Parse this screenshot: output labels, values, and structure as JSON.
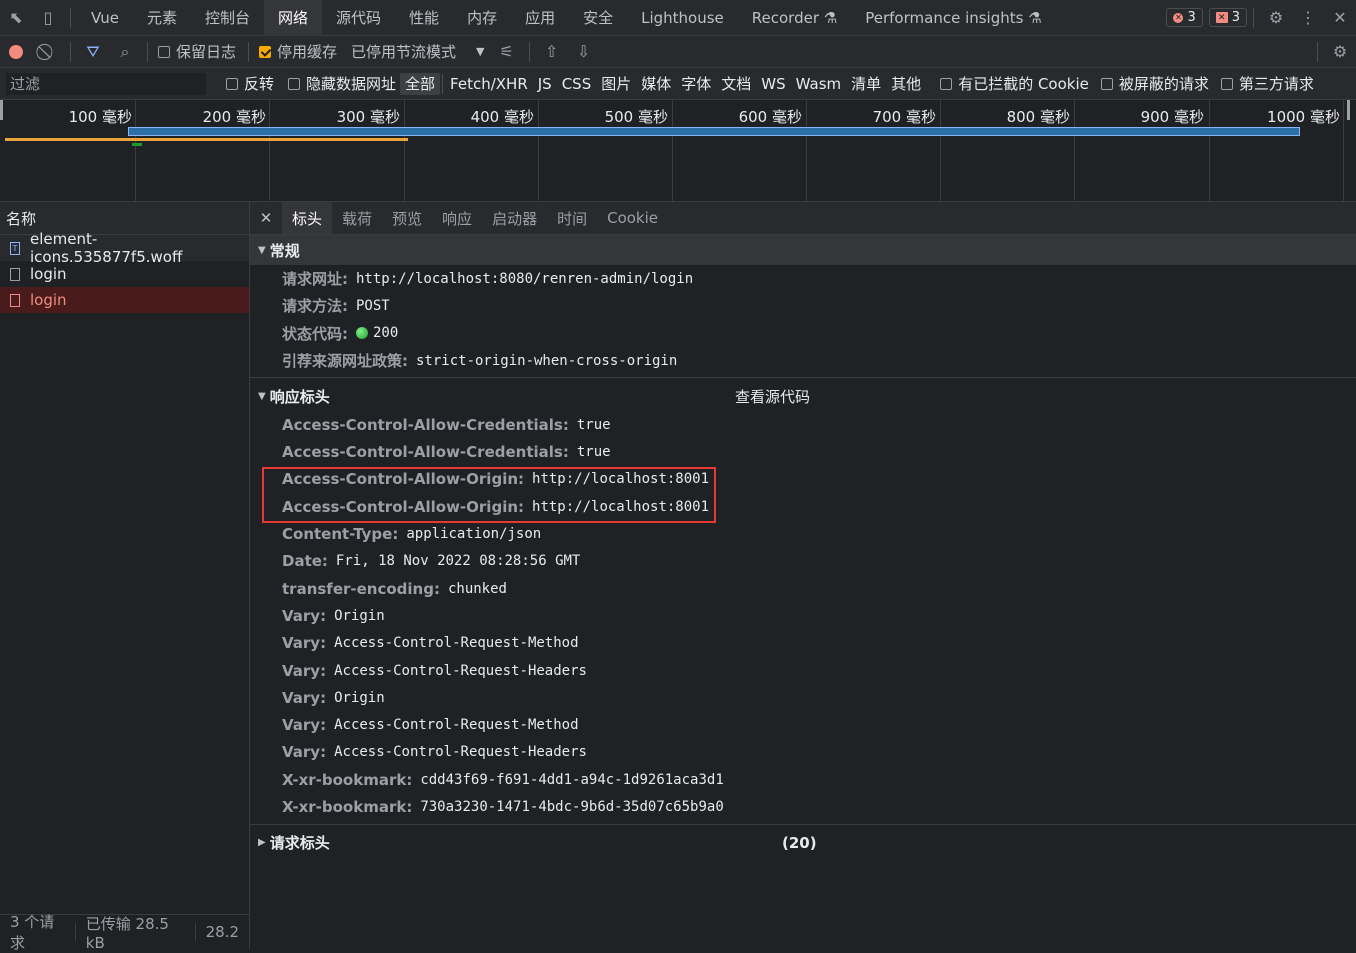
{
  "tabbar": {
    "tabs": [
      "Vue",
      "元素",
      "控制台",
      "网络",
      "源代码",
      "性能",
      "内存",
      "应用",
      "安全",
      "Lighthouse",
      "Recorder",
      "Performance insights"
    ],
    "active_tab": "网络",
    "error_count": "3",
    "issue_count": "3"
  },
  "toolbar": {
    "preserve_log": "保留日志",
    "disable_cache": "停用缓存",
    "throttling": "已停用节流模式"
  },
  "filterbar": {
    "filter_placeholder": "过滤",
    "invert": "反转",
    "hide_data_urls": "隐藏数据网址",
    "types": [
      "全部",
      "Fetch/XHR",
      "JS",
      "CSS",
      "图片",
      "媒体",
      "字体",
      "文档",
      "WS",
      "Wasm",
      "清单",
      "其他"
    ],
    "blocked_cookies": "有已拦截的 Cookie",
    "blocked_requests": "被屏蔽的请求",
    "third_party": "第三方请求"
  },
  "overview": {
    "ticks": [
      "100 毫秒",
      "200 毫秒",
      "300 毫秒",
      "400 毫秒",
      "500 毫秒",
      "600 毫秒",
      "700 毫秒",
      "800 毫秒",
      "900 毫秒",
      "1000 毫秒"
    ]
  },
  "requests": {
    "header": "名称",
    "items": [
      {
        "name": "element-icons.535877f5.woff"
      },
      {
        "name": "login"
      },
      {
        "name": "login"
      }
    ],
    "summary": {
      "count": "3 个请求",
      "transferred": "已传输 28.5 kB",
      "resources": "28.2"
    }
  },
  "details": {
    "tabs": [
      "标头",
      "载荷",
      "预览",
      "响应",
      "启动器",
      "时间",
      "Cookie"
    ],
    "general": {
      "title": "常规",
      "rows": [
        {
          "name": "请求网址:",
          "value": "http://localhost:8080/renren-admin/login"
        },
        {
          "name": "请求方法:",
          "value": "POST"
        },
        {
          "name": "状态代码:",
          "value": "200"
        },
        {
          "name": "引荐来源网址政策:",
          "value": "strict-origin-when-cross-origin"
        }
      ]
    },
    "response_headers": {
      "title": "响应标头",
      "view_source": "查看源代码",
      "rows": [
        {
          "name": "Access-Control-Allow-Credentials:",
          "value": "true"
        },
        {
          "name": "Access-Control-Allow-Credentials:",
          "value": "true"
        },
        {
          "name": "Access-Control-Allow-Origin:",
          "value": "http://localhost:8001"
        },
        {
          "name": "Access-Control-Allow-Origin:",
          "value": "http://localhost:8001"
        },
        {
          "name": "Content-Type:",
          "value": "application/json"
        },
        {
          "name": "Date:",
          "value": "Fri, 18 Nov 2022 08:28:56 GMT"
        },
        {
          "name": "transfer-encoding:",
          "value": "chunked"
        },
        {
          "name": "Vary:",
          "value": "Origin"
        },
        {
          "name": "Vary:",
          "value": "Access-Control-Request-Method"
        },
        {
          "name": "Vary:",
          "value": "Access-Control-Request-Headers"
        },
        {
          "name": "Vary:",
          "value": "Origin"
        },
        {
          "name": "Vary:",
          "value": "Access-Control-Request-Method"
        },
        {
          "name": "Vary:",
          "value": "Access-Control-Request-Headers"
        },
        {
          "name": "X-xr-bookmark:",
          "value": "cdd43f69-f691-4dd1-a94c-1d9261aca3d1"
        },
        {
          "name": "X-xr-bookmark:",
          "value": "730a3230-1471-4bdc-9b6d-35d07c65b9a0"
        }
      ]
    },
    "request_headers": {
      "title": "请求标头",
      "count": "(20)"
    }
  },
  "colors": {
    "background": "#202124",
    "highlight_box": "#e53935",
    "error_row": "#f28b82",
    "status_ok": "#1e9c2a"
  }
}
